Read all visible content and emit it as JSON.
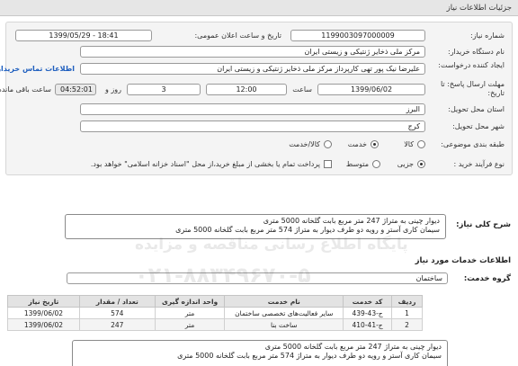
{
  "header": {
    "title": "جزئیات اطلاعات نیاز"
  },
  "form": {
    "need_number": {
      "label": "شماره نیاز:",
      "value": "1199003097000009"
    },
    "announce_datetime": {
      "label": "تاریخ و ساعت اعلان عمومی:",
      "value": "1399/05/29 - 18:41"
    },
    "buyer_org": {
      "label": "نام دستگاه خریدار:",
      "value": "مرکز ملی ذخایر ژنتیکی و زیستی ایران"
    },
    "creator": {
      "label": "ایجاد کننده درخواست:",
      "value": "علیرضا نیک پور تهی کارپرداز مرکز ملی ذخایر ژنتیکی و زیستی ایران"
    },
    "contact_link": "اطلاعات تماس خریدار",
    "deadline": {
      "label": "مهلت ارسال پاسخ: تا تاریخ:",
      "date": "1399/06/02",
      "time_label": "ساعت",
      "time": "12:00",
      "days": "3",
      "days_label": "روز و",
      "remaining": "04:52:01",
      "remaining_label": "ساعت باقی مانده"
    },
    "province": {
      "label": "استان محل تحویل:",
      "value": "البرز"
    },
    "city": {
      "label": "شهر محل تحویل:",
      "value": "کرج"
    },
    "category": {
      "label": "طبقه بندی موضوعی:",
      "options": [
        "کالا",
        "خدمت",
        "کالا/خدمت"
      ],
      "selected": "خدمت"
    },
    "process_type": {
      "label": "نوع فرآیند خرید :",
      "options": [
        "جزیی",
        "متوسط"
      ],
      "selected": "جزیی",
      "payment_note": "پرداخت تمام یا بخشی از مبلغ خرید،از محل \"اسناد خزانه اسلامی\" خواهد بود."
    }
  },
  "summary": {
    "label": "شرح کلی نیاز:",
    "lines": [
      "دیوار چینی به متراژ 247 متر مربع بابت گلخانه 5000 متری",
      "سیمان کاری آستر و رویه دو طرف دیوار به متراژ 574 متر مربع بابت گلخانه 5000 متری"
    ]
  },
  "services": {
    "title": "اطلاعات خدمات مورد نیاز",
    "group_label": "گروه خدمت:",
    "group_value": "ساختمان",
    "columns": [
      "ردیف",
      "کد خدمت",
      "نام خدمت",
      "واحد اندازه گیری",
      "تعداد / مقدار",
      "تاریخ نیاز"
    ],
    "rows": [
      {
        "row": "1",
        "code": "ج-43-439",
        "name": "سایر فعالیت‌های تخصصی ساختمان",
        "unit": "متر",
        "qty": "574",
        "date": "1399/06/02"
      },
      {
        "row": "2",
        "code": "ج-41-410",
        "name": "ساخت بنا",
        "unit": "متر",
        "qty": "247",
        "date": "1399/06/02"
      }
    ]
  },
  "buyer_notes": {
    "lines": [
      "دیوار چینی به متراژ 247 متر مربع بابت گلخانه 5000 متری",
      "سیمان کاری آستر و رویه دو طرف دیوار به متراژ 574 متر مربع بابت گلخانه 5000 متری"
    ]
  },
  "watermark": {
    "line1": "پایگاه اطلاع رسانی مناقصه و مزایده",
    "line2": "۰۲۱-۸۸۳۴۹۶۷۰-۵"
  }
}
